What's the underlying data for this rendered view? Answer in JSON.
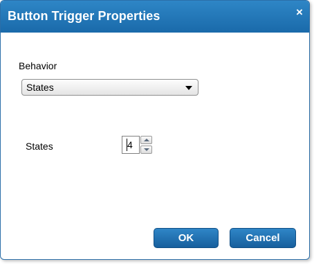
{
  "dialog": {
    "title": "Button Trigger Properties",
    "close_glyph": "×"
  },
  "behavior": {
    "label": "Behavior",
    "selected": "States"
  },
  "states": {
    "label": "States",
    "value": "4"
  },
  "buttons": {
    "ok": "OK",
    "cancel": "Cancel"
  },
  "colors": {
    "accent": "#1f72b6",
    "text": "#000000"
  },
  "icons": {
    "close": "close-icon",
    "dropdown": "chevron-down-icon",
    "spin_up": "spin-up-icon",
    "spin_down": "spin-down-icon"
  }
}
